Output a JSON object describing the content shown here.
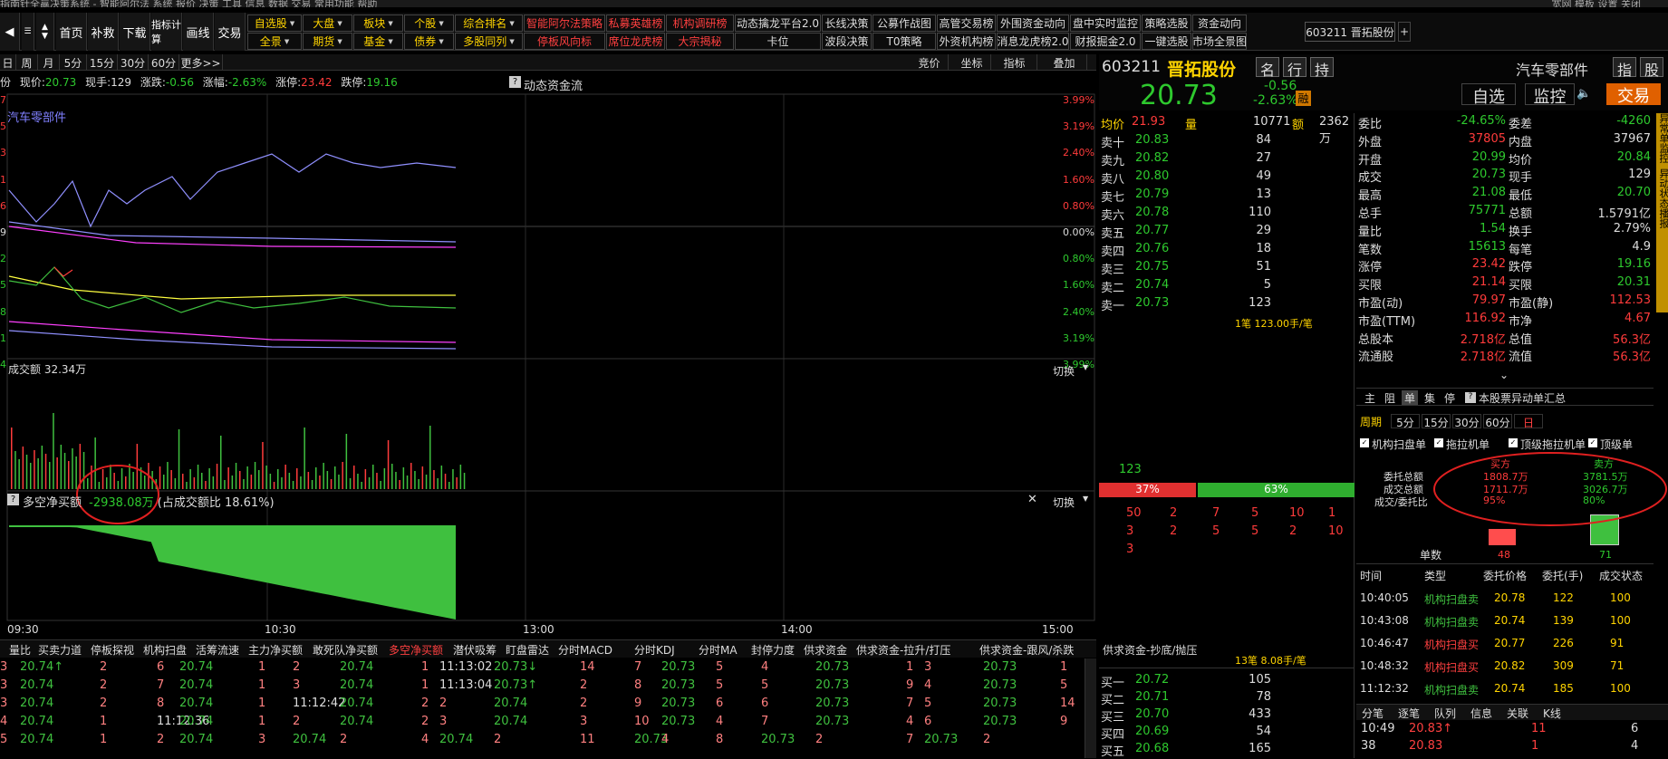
{
  "topbar": {
    "text": "指南针全赢决策系统 - 智能阿尔法        系统  报价  决策  工具  信息  数据  交易  常用功能  帮助",
    "right": "宽网  模板  设置  关闭"
  },
  "toolbar": {
    "nav_buttons": [
      "首页",
      "补救",
      "下载",
      "指标计算",
      "画线",
      "交易"
    ],
    "row1": [
      "自选股",
      "大盘",
      "板块",
      "个股",
      "综合排名",
      "智能阿尔法策略",
      "私募英雄榜",
      "机构调研榜",
      "动态擒龙平台2.0",
      "长线决策",
      "公募作战图",
      "高管交易榜",
      "外围资金动向",
      "盘中实时监控",
      "策略选股",
      "资金动向"
    ],
    "row2": [
      "全景",
      "期货",
      "基金",
      "债券",
      "多股同列",
      "停板风向标",
      "席位龙虎榜",
      "大宗揭秘",
      "卡位",
      "波段决策",
      "T0策略",
      "外资机构榜",
      "消息龙虎榜2.0",
      "财报掘金2.0",
      "一键选股",
      "市场全景图"
    ],
    "stock_tab": "603211 晋拓股份"
  },
  "periods": [
    "日",
    "周",
    "月",
    "5分",
    "15分",
    "30分",
    "60分",
    "更多>>"
  ],
  "period_right": [
    "竞价",
    "坐标",
    "指标",
    "叠加"
  ],
  "quote": {
    "prefix": "份",
    "price_label": "现价:",
    "price": "20.73",
    "vol_label": "现手:",
    "vol": "129",
    "chg_label": "涨跌:",
    "chg": "-0.56",
    "pct_label": "涨幅:",
    "pct": "-2.63%",
    "up_label": "涨停:",
    "up": "23.42",
    "dn_label": "跌停:",
    "dn": "19.16",
    "flow": "动态资金流"
  },
  "chart": {
    "sector": "汽车零部件",
    "pct_labels": [
      "3.99%",
      "3.19%",
      "2.40%",
      "1.60%",
      "0.80%",
      "0.00%",
      "0.80%",
      "1.60%",
      "2.40%",
      "3.19%",
      "3.99%"
    ],
    "left_labels": [
      "7",
      "5",
      "3",
      "1",
      "6",
      "9",
      "2",
      "5",
      "8",
      "1",
      "4"
    ],
    "volume_title": "成交额 32.34万",
    "switch": "切换",
    "net_title": "多空净买额",
    "net_value": "-2938.08万",
    "net_ratio": "(占成交额比 18.61%)",
    "times": [
      "09:30",
      "10:30",
      "13:00",
      "14:00",
      "15:00"
    ]
  },
  "bottom_tabs": [
    "量比",
    "买卖力道",
    "停板探视",
    "机构扫盘",
    "活筹流速",
    "主力净买额",
    "敢死队净买额",
    "多空净买额",
    "潜伏吸筹",
    "盯盘雷达",
    "分时MACD",
    "分时KDJ",
    "分时MA",
    "封停力度",
    "供求资金",
    "供求资金-拉升/打压",
    "供求资金-跟风/杀跌",
    "供求资金-抄底/抛压"
  ],
  "bottom_rows": [
    [
      "3",
      "20.74↑",
      "2",
      "6",
      "20.74",
      "1",
      "2",
      "20.74",
      "1",
      "11:13:02",
      "20.73↓",
      "14",
      "7",
      "20.73",
      "5",
      "4",
      "20.73",
      "1",
      "3",
      "20.73",
      "1"
    ],
    [
      "3",
      "20.74",
      "2",
      "7",
      "20.74",
      "1",
      "3",
      "20.74",
      "1",
      "11:13:04",
      "20.73↑",
      "2",
      "8",
      "20.73",
      "5",
      "5",
      "20.73",
      "9",
      "4",
      "20.73",
      "5"
    ],
    [
      "3",
      "20.74",
      "2",
      "8",
      "20.74",
      "1",
      "11:12:42",
      "20.74",
      "2",
      "2",
      "20.74",
      "2",
      "9",
      "20.73",
      "6",
      "6",
      "20.73",
      "7",
      "5",
      "20.73",
      "14"
    ],
    [
      "4",
      "20.74",
      "1",
      "11:12:36",
      "20.74",
      "1",
      "2",
      "20.74",
      "2",
      "3",
      "20.74",
      "3",
      "10",
      "20.73",
      "4",
      "7",
      "20.73",
      "4",
      "6",
      "20.73",
      "9"
    ],
    [
      "5",
      "20.74",
      "1",
      "2",
      "20.74",
      "3",
      "20.74",
      "2",
      "4",
      "20.74",
      "2",
      "11",
      "20.73",
      "4",
      "8",
      "20.73",
      "2",
      "7",
      "20.73",
      "2"
    ]
  ],
  "header": {
    "code": "603211",
    "name": "晋拓股份",
    "btns": [
      "名",
      "行",
      "持"
    ],
    "industry": "汽车零部件",
    "right_btns": [
      "指",
      "股"
    ],
    "price": "20.73",
    "chg": "-0.56",
    "pct": "-2.63%",
    "rong": "融",
    "zixuan": "自选",
    "jiankong": "监控",
    "jiaoyi": "交易"
  },
  "book_head": {
    "avg_label": "均价",
    "avg": "21.93",
    "vol_label": "量",
    "vol": "10771",
    "amt_label": "额",
    "amt": "2362万"
  },
  "sell_levels": [
    {
      "label": "卖十",
      "price": "20.83",
      "qty": "84"
    },
    {
      "label": "卖九",
      "price": "20.82",
      "qty": "27"
    },
    {
      "label": "卖八",
      "price": "20.80",
      "qty": "49"
    },
    {
      "label": "卖七",
      "price": "20.79",
      "qty": "13"
    },
    {
      "label": "卖六",
      "price": "20.78",
      "qty": "110"
    },
    {
      "label": "卖五",
      "price": "20.77",
      "qty": "29"
    },
    {
      "label": "卖四",
      "price": "20.76",
      "qty": "18"
    },
    {
      "label": "卖三",
      "price": "20.75",
      "qty": "51"
    },
    {
      "label": "卖二",
      "price": "20.74",
      "qty": "5"
    },
    {
      "label": "卖一",
      "price": "20.73",
      "qty": "123"
    }
  ],
  "book_mid": {
    "top_note": "1笔 123.00手/笔",
    "qty_123": "123",
    "buy_pct": "37%",
    "sell_pct": "63%",
    "queue1": [
      "50",
      "2",
      "7",
      "5",
      "10",
      "1"
    ],
    "queue2": [
      "3",
      "2",
      "5",
      "5",
      "2",
      "10"
    ],
    "queue3": [
      "3"
    ],
    "bottom_note": "13笔 8.08手/笔"
  },
  "buy_levels": [
    {
      "label": "买一",
      "price": "20.72",
      "qty": "105"
    },
    {
      "label": "买二",
      "price": "20.71",
      "qty": "78"
    },
    {
      "label": "买三",
      "price": "20.70",
      "qty": "433"
    },
    {
      "label": "买四",
      "price": "20.69",
      "qty": "54"
    },
    {
      "label": "买五",
      "price": "20.68",
      "qty": "165"
    }
  ],
  "fin": [
    [
      "委比",
      "-24.65%",
      "委差",
      "-4260"
    ],
    [
      "外盘",
      "37805",
      "内盘",
      "37967"
    ],
    [
      "开盘",
      "20.99",
      "均价",
      "20.84"
    ],
    [
      "成交",
      "20.73",
      "现手",
      "129"
    ],
    [
      "最高",
      "21.08",
      "最低",
      "20.70"
    ],
    [
      "总手",
      "75771",
      "总额",
      "1.5791亿"
    ],
    [
      "量比",
      "1.54",
      "换手",
      "2.79%"
    ],
    [
      "笔数",
      "15613",
      "每笔",
      "4.9"
    ],
    [
      "涨停",
      "23.42",
      "跌停",
      "19.16"
    ],
    [
      "买限",
      "21.14",
      "买限",
      "20.31"
    ],
    [
      "市盈(动)",
      "79.97",
      "市盈(静)",
      "112.53"
    ],
    [
      "市盈(TTM)",
      "116.92",
      "市净",
      "4.67"
    ],
    [
      "总股本",
      "2.718亿",
      "总值",
      "56.3亿"
    ],
    [
      "流通股",
      "2.718亿",
      "流值",
      "56.3亿"
    ]
  ],
  "side_tabs": [
    "主",
    "阻",
    "单",
    "集",
    "停"
  ],
  "side_summary": "本股票异动单汇总",
  "side_period_label": "周期",
  "side_periods": [
    "5分",
    "15分",
    "30分",
    "60分",
    "日"
  ],
  "checkboxes": [
    "机构扫盘单",
    "拖拉机单",
    "顶级拖拉机单",
    "顶级单"
  ],
  "stats": {
    "buy_head": "买方",
    "sell_head": "卖方",
    "rows": [
      [
        "委托总额",
        "1808.7万",
        "3781.5万"
      ],
      [
        "成交总额",
        "1711.7万",
        "3026.7万"
      ],
      [
        "成交/委托比",
        "95%",
        "80%"
      ]
    ],
    "count_label": "单数",
    "buy_count": "48",
    "sell_count": "71"
  },
  "trade_head": [
    "时间",
    "类型",
    "委托价格",
    "委托(手)",
    "成交状态"
  ],
  "trades": [
    [
      "10:40:05",
      "机构扫盘卖",
      "20.78",
      "122",
      "100"
    ],
    [
      "10:43:08",
      "机构扫盘卖",
      "20.74",
      "139",
      "100"
    ],
    [
      "10:46:47",
      "机构扫盘买",
      "20.77",
      "226",
      "91"
    ],
    [
      "10:48:32",
      "机构扫盘买",
      "20.82",
      "309",
      "71"
    ],
    [
      "11:12:32",
      "机构扫盘卖",
      "20.74",
      "185",
      "100"
    ]
  ],
  "bottom_right_tabs": [
    "分笔",
    "逐笔",
    "队列",
    "信息",
    "关联",
    "K线"
  ],
  "ticks": [
    [
      "10:49",
      "20.83↑",
      "11",
      "6"
    ],
    [
      "38",
      "20.83",
      "1",
      "4"
    ]
  ],
  "vertical_strip": [
    "异常单监控",
    "异动状态播报"
  ]
}
